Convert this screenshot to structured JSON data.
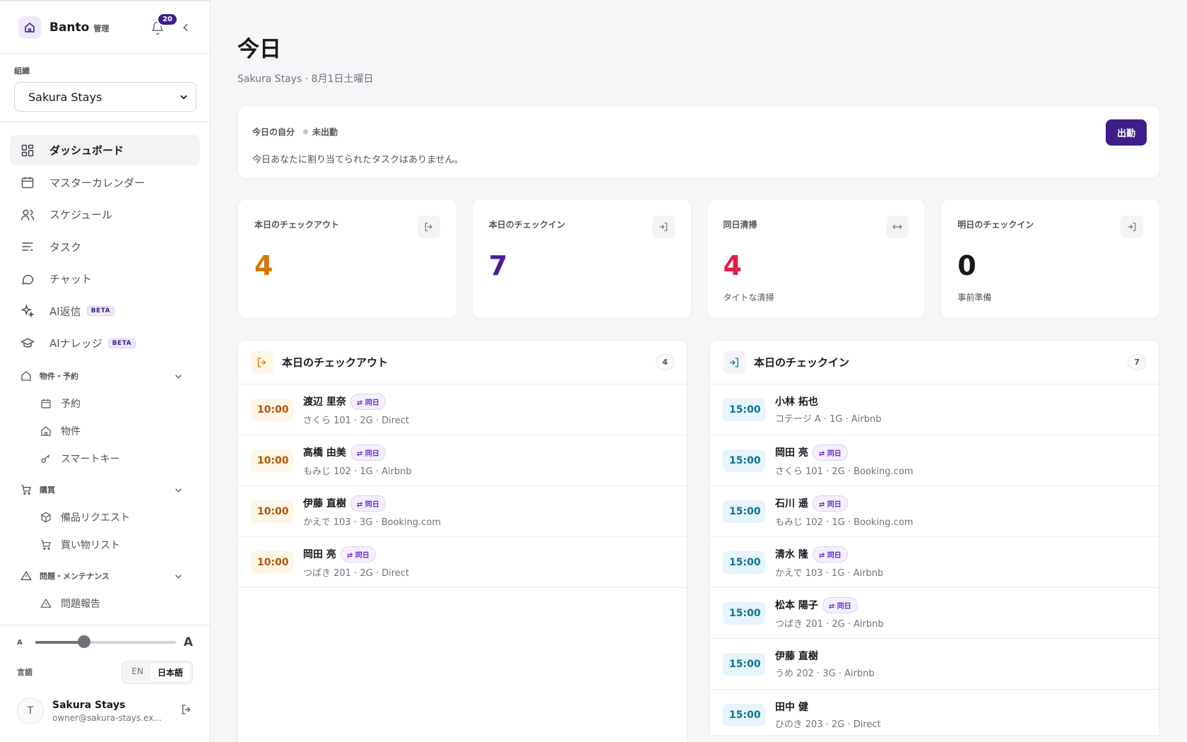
{
  "sidebar": {
    "brand": "Banto",
    "brand_sub": "管理",
    "notif_count": "20",
    "org_label": "組織",
    "org_value": "Sakura Stays",
    "nav": [
      {
        "label": "ダッシュボード",
        "icon": "grid-icon",
        "active": true
      },
      {
        "label": "マスターカレンダー",
        "icon": "calendar-icon"
      },
      {
        "label": "スケジュール",
        "icon": "users-icon"
      },
      {
        "label": "タスク",
        "icon": "list-icon"
      },
      {
        "label": "チャット",
        "icon": "chat-icon"
      },
      {
        "label": "AI返信",
        "icon": "sparkle-icon",
        "badge": "BETA"
      },
      {
        "label": "AIナレッジ",
        "icon": "graduation-cap-icon",
        "badge": "BETA"
      }
    ],
    "groups": [
      {
        "label": "物件・予約",
        "icon": "home-icon",
        "items": [
          {
            "label": "予約",
            "icon": "calendar-icon"
          },
          {
            "label": "物件",
            "icon": "home-icon"
          },
          {
            "label": "スマートキー",
            "icon": "key-icon"
          }
        ]
      },
      {
        "label": "購買",
        "icon": "cart-icon",
        "items": [
          {
            "label": "備品リクエスト",
            "icon": "box-icon"
          },
          {
            "label": "買い物リスト",
            "icon": "cart-icon"
          }
        ]
      },
      {
        "label": "問題・メンテナンス",
        "icon": "warning-icon",
        "items": [
          {
            "label": "問題報告",
            "icon": "warning-icon"
          }
        ]
      }
    ],
    "font_size_small": "A",
    "font_size_large": "A",
    "font_scale_fraction": 0.35,
    "lang_label": "言語",
    "lang_en": "EN",
    "lang_ja": "日本語",
    "user_initial": "T",
    "user_name": "Sakura Stays",
    "user_email": "owner@sakura-stays.ex..."
  },
  "main": {
    "title": "今日",
    "subtitle": "Sakura Stays · 8月1日土曜日",
    "me": {
      "label": "今日の自分",
      "status": "未出勤",
      "message": "今日あなたに割り当てられたタスクはありません。",
      "clockin": "出勤"
    },
    "stats": [
      {
        "label": "本日のチェックアウト",
        "value": "4",
        "note": "",
        "color": "#d97706",
        "icon": "logout-icon"
      },
      {
        "label": "本日のチェックイン",
        "value": "7",
        "note": "",
        "color": "#4c1d95",
        "icon": "login-icon"
      },
      {
        "label": "同日清掃",
        "value": "4",
        "note": "タイトな清掃",
        "color": "#e11d48",
        "icon": "swap-icon"
      },
      {
        "label": "明日のチェックイン",
        "value": "0",
        "note": "事前準備",
        "color": "#18181b",
        "icon": "login-icon"
      }
    ],
    "checkout": {
      "title": "本日のチェックアウト",
      "count": "4",
      "rows": [
        {
          "time": "10:00",
          "name": "渡辺 里奈",
          "tag": "⇄ 同日",
          "meta": "さくら 101 · 2G · Direct"
        },
        {
          "time": "10:00",
          "name": "高橋 由美",
          "tag": "⇄ 同日",
          "meta": "もみじ 102 · 1G · Airbnb"
        },
        {
          "time": "10:00",
          "name": "伊藤 直樹",
          "tag": "⇄ 同日",
          "meta": "かえで 103 · 3G · Booking.com"
        },
        {
          "time": "10:00",
          "name": "岡田 亮",
          "tag": "⇄ 同日",
          "meta": "つばき 201 · 2G · Direct"
        }
      ]
    },
    "checkin": {
      "title": "本日のチェックイン",
      "count": "7",
      "rows": [
        {
          "time": "15:00",
          "name": "小林 拓也",
          "tag": "",
          "meta": "コテージ A · 1G · Airbnb"
        },
        {
          "time": "15:00",
          "name": "岡田 亮",
          "tag": "⇄ 同日",
          "meta": "さくら 101 · 2G · Booking.com"
        },
        {
          "time": "15:00",
          "name": "石川 遥",
          "tag": "⇄ 同日",
          "meta": "もみじ 102 · 1G · Booking.com"
        },
        {
          "time": "15:00",
          "name": "清水 隆",
          "tag": "⇄ 同日",
          "meta": "かえで 103 · 1G · Airbnb"
        },
        {
          "time": "15:00",
          "name": "松本 陽子",
          "tag": "⇄ 同日",
          "meta": "つばき 201 · 2G · Airbnb"
        },
        {
          "time": "15:00",
          "name": "伊藤 直樹",
          "tag": "",
          "meta": "うめ 202 · 3G · Airbnb"
        },
        {
          "time": "15:00",
          "name": "田中 健",
          "tag": "",
          "meta": "ひのき 203 · 2G · Direct"
        }
      ]
    }
  }
}
